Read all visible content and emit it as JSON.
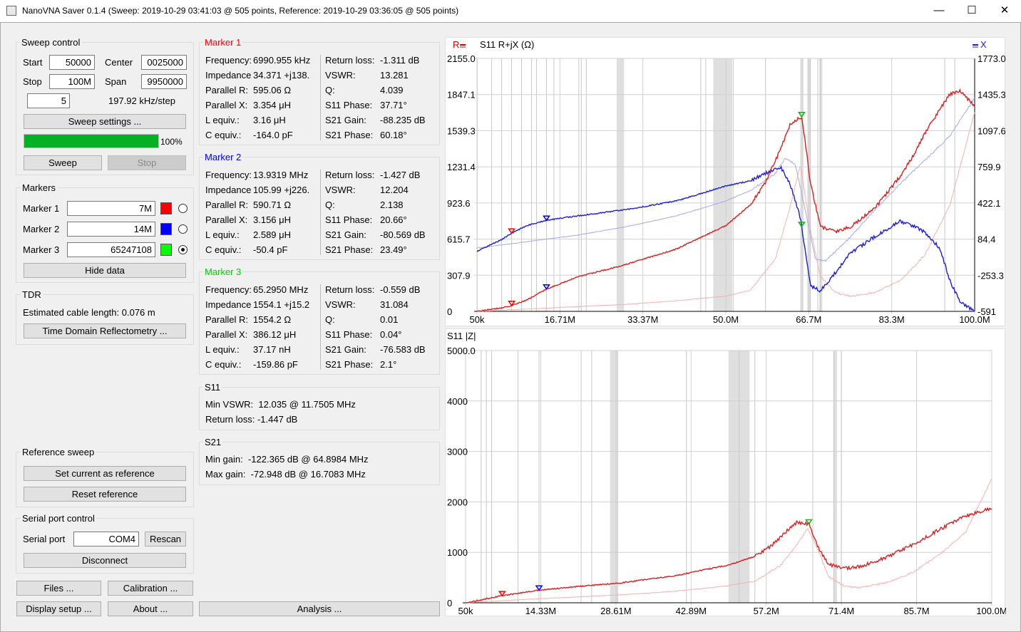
{
  "window": {
    "title": "NanoVNA Saver 0.1.4 (Sweep: 2019-10-29 03:41:03 @ 505 points, Reference: 2019-10-29 03:36:05 @ 505 points)",
    "minimize": "—",
    "maximize": "☐",
    "close": "✕"
  },
  "sweep_control": {
    "title": "Sweep control",
    "start_label": "Start",
    "start_value": "50000",
    "center_label": "Center",
    "center_value": "0025000",
    "stop_label": "Stop",
    "stop_value": "100M",
    "span_label": "Span",
    "span_value": "9950000",
    "segments_value": "5",
    "step_text": "197.92 kHz/step",
    "settings_button": "Sweep settings ...",
    "progress": 1.0,
    "progress_text": "100%",
    "sweep_button": "Sweep",
    "stop_button": "Stop"
  },
  "markers": {
    "title": "Markers",
    "items": [
      {
        "label": "Marker 1",
        "value": "7M",
        "color": "#ff0000",
        "selected": false
      },
      {
        "label": "Marker 2",
        "value": "14M",
        "color": "#0000ff",
        "selected": false
      },
      {
        "label": "Marker 3",
        "value": "65247108",
        "color": "#00ff00",
        "selected": true
      }
    ],
    "hide_button": "Hide data"
  },
  "tdr": {
    "title": "TDR",
    "cable_text": "Estimated cable length: 0.076 m",
    "button": "Time Domain Reflectometry ..."
  },
  "reference_sweep": {
    "title": "Reference sweep",
    "set_button": "Set current as reference",
    "reset_button": "Reset reference"
  },
  "serial": {
    "title": "Serial port control",
    "port_label": "Serial port",
    "port_value": "COM4",
    "rescan_button": "Rescan",
    "disconnect_button": "Disconnect"
  },
  "bottom_buttons": {
    "files": "Files ...",
    "calibration": "Calibration ...",
    "display_setup": "Display setup ...",
    "about": "About ...",
    "analysis": "Analysis ..."
  },
  "marker_details": [
    {
      "title": "Marker 1",
      "color": "#ff0000",
      "left": [
        [
          "Frequency:",
          "6990.955 kHz"
        ],
        [
          "Impedance:",
          "34.371 +j138."
        ],
        [
          "Parallel R:",
          "595.06 Ω"
        ],
        [
          "Parallel X:",
          "3.354 μH"
        ],
        [
          "L equiv.:",
          "3.16 μH"
        ],
        [
          "C equiv.:",
          "-164.0 pF"
        ]
      ],
      "right": [
        [
          "Return loss:",
          "-1.311 dB"
        ],
        [
          "VSWR:",
          "13.281"
        ],
        [
          "Q:",
          "4.039"
        ],
        [
          "S11 Phase:",
          "37.71°"
        ],
        [
          "S21 Gain:",
          "-88.235 dB"
        ],
        [
          "S21 Phase:",
          "60.18°"
        ]
      ]
    },
    {
      "title": "Marker 2",
      "color": "#0000ff",
      "left": [
        [
          "Frequency:",
          "13.9319 MHz"
        ],
        [
          "Impedance:",
          "105.99 +j226."
        ],
        [
          "Parallel R:",
          "590.71 Ω"
        ],
        [
          "Parallel X:",
          "3.156 μH"
        ],
        [
          "L equiv.:",
          "2.589 μH"
        ],
        [
          "C equiv.:",
          "-50.4 pF"
        ]
      ],
      "right": [
        [
          "Return loss:",
          "-1.427 dB"
        ],
        [
          "VSWR:",
          "12.204"
        ],
        [
          "Q:",
          "2.138"
        ],
        [
          "S11 Phase:",
          "20.66°"
        ],
        [
          "S21 Gain:",
          "-80.569 dB"
        ],
        [
          "S21 Phase:",
          "23.49°"
        ]
      ]
    },
    {
      "title": "Marker 3",
      "color": "#00d000",
      "left": [
        [
          "Frequency:",
          "65.2950 MHz"
        ],
        [
          "Impedance:",
          "1554.1 +j15.2"
        ],
        [
          "Parallel R:",
          "1554.2 Ω"
        ],
        [
          "Parallel X:",
          "386.12 μH"
        ],
        [
          "L equiv.:",
          "37.17 nH"
        ],
        [
          "C equiv.:",
          "-159.86 pF"
        ]
      ],
      "right": [
        [
          "Return loss:",
          "-0.559 dB"
        ],
        [
          "VSWR:",
          "31.084"
        ],
        [
          "Q:",
          "0.01"
        ],
        [
          "S11 Phase:",
          "0.04°"
        ],
        [
          "S21 Gain:",
          "-76.583 dB"
        ],
        [
          "S21 Phase:",
          "2.1°"
        ]
      ]
    }
  ],
  "s11_summary": {
    "title": "S11",
    "min_vswr": "Min VSWR:  12.035 @ 11.7505 MHz",
    "return_loss": "Return loss: -1.447 dB"
  },
  "s21_summary": {
    "title": "S21",
    "min_gain": "Min gain:  -122.365 dB @ 64.8984 MHz",
    "max_gain": "Max gain:  -72.948 dB @ 16.7083 MHz"
  },
  "chart_data": [
    {
      "type": "line",
      "title": "S11  R+jX (Ω)",
      "left_legend": "R",
      "right_legend": "X",
      "x_unit": "MHz",
      "xlim": [
        0.05,
        100
      ],
      "x_tick_labels": [
        "50k",
        "16.71M",
        "33.37M",
        "50.0M",
        "66.7M",
        "83.3M",
        "100.0M"
      ],
      "y_left_tick_labels": [
        "2155.0",
        "1847.1",
        "1539.3",
        "1231.4",
        "923.6",
        "615.7",
        "307.9",
        "0"
      ],
      "y_right_tick_labels": [
        "1773.0",
        "1435.3",
        "1097.6",
        "759.9",
        "422.1",
        "84.4",
        "-253.3",
        "-591"
      ],
      "ylim_left": [
        0,
        2155.0
      ],
      "ylim_right": [
        -591,
        1773.0
      ],
      "series": [
        {
          "name": "R",
          "axis": "left",
          "color": "#d62020",
          "x": [
            0.05,
            5,
            7,
            10,
            14,
            20,
            30,
            40,
            50,
            55,
            58,
            61,
            63,
            65.3,
            67,
            69,
            72,
            75,
            80,
            85,
            88,
            90,
            93,
            95,
            97,
            100
          ],
          "y": [
            0,
            30,
            50,
            95,
            190,
            290,
            400,
            530,
            730,
            910,
            1100,
            1380,
            1600,
            1660,
            1100,
            720,
            680,
            720,
            880,
            1150,
            1350,
            1520,
            1720,
            1850,
            1880,
            1750
          ]
        },
        {
          "name": "X",
          "axis": "right",
          "color": "#1e1ed2",
          "x": [
            0.05,
            5,
            7,
            10,
            14,
            20,
            30,
            40,
            50,
            55,
            58,
            61,
            63,
            65,
            67,
            69,
            72,
            75,
            80,
            85,
            88,
            90,
            93,
            95,
            97,
            100
          ],
          "y": [
            -30,
            80,
            140,
            210,
            260,
            300,
            360,
            440,
            580,
            630,
            700,
            760,
            590,
            280,
            -350,
            -400,
            -230,
            -50,
            110,
            250,
            200,
            150,
            0,
            -300,
            -500,
            -591
          ]
        },
        {
          "name": "R (reference)",
          "axis": "left",
          "color": "#f5b0b0",
          "x": [
            0.05,
            10,
            20,
            30,
            40,
            50,
            55,
            60,
            63,
            65,
            67,
            69,
            72,
            75,
            80,
            85,
            90,
            95,
            100
          ],
          "y": [
            0,
            20,
            40,
            60,
            90,
            130,
            180,
            450,
            900,
            1250,
            700,
            300,
            160,
            130,
            160,
            260,
            480,
            900,
            1700
          ]
        },
        {
          "name": "X (reference)",
          "axis": "right",
          "color": "#a8a8ec",
          "x": [
            0.05,
            10,
            20,
            30,
            40,
            50,
            55,
            60,
            62,
            64,
            66,
            68,
            70,
            75,
            80,
            85,
            90,
            95,
            100
          ],
          "y": [
            0,
            60,
            120,
            200,
            300,
            440,
            540,
            700,
            840,
            780,
            350,
            -100,
            -120,
            100,
            360,
            600,
            820,
            1050,
            1400
          ]
        }
      ],
      "markers": [
        {
          "label": "Marker 1",
          "x": 7,
          "color": "#ff0000"
        },
        {
          "label": "Marker 2",
          "x": 14,
          "color": "#0000ff"
        },
        {
          "label": "Marker 3",
          "x": 65.25,
          "color": "#00c000"
        }
      ]
    },
    {
      "type": "line",
      "title": "S11  |Z|",
      "x_unit": "MHz",
      "xlim": [
        0.05,
        100
      ],
      "x_tick_labels": [
        "50k",
        "14.33M",
        "28.61M",
        "42.89M",
        "57.2M",
        "71.4M",
        "85.7M",
        "100.0M"
      ],
      "y_tick_labels": [
        "5000.0",
        "4000",
        "3000",
        "2000",
        "1000",
        "0"
      ],
      "ylim": [
        0,
        5000
      ],
      "series": [
        {
          "name": "|Z|",
          "color": "#d62020",
          "x": [
            0.05,
            7,
            14,
            20,
            30,
            40,
            50,
            55,
            58,
            61,
            63,
            65.3,
            67,
            69,
            72,
            75,
            80,
            85,
            90,
            95,
            100
          ],
          "y": [
            0,
            140,
            250,
            310,
            400,
            540,
            750,
            920,
            1120,
            1420,
            1600,
            1560,
            1100,
            760,
            680,
            720,
            900,
            1150,
            1450,
            1720,
            1880
          ]
        },
        {
          "name": "|Z| (reference)",
          "color": "#f5b0b0",
          "x": [
            0.05,
            10,
            20,
            30,
            40,
            50,
            55,
            60,
            63,
            65,
            67,
            69,
            72,
            75,
            80,
            85,
            90,
            95,
            100
          ],
          "y": [
            0,
            60,
            110,
            160,
            230,
            340,
            430,
            750,
            1150,
            1480,
            1050,
            520,
            330,
            300,
            400,
            600,
            950,
            1400,
            2450
          ]
        }
      ],
      "markers": [
        {
          "label": "Marker 1",
          "x": 7,
          "color": "#ff0000"
        },
        {
          "label": "Marker 2",
          "x": 14,
          "color": "#0000ff"
        },
        {
          "label": "Marker 3",
          "x": 65.25,
          "color": "#00c000"
        }
      ]
    }
  ]
}
